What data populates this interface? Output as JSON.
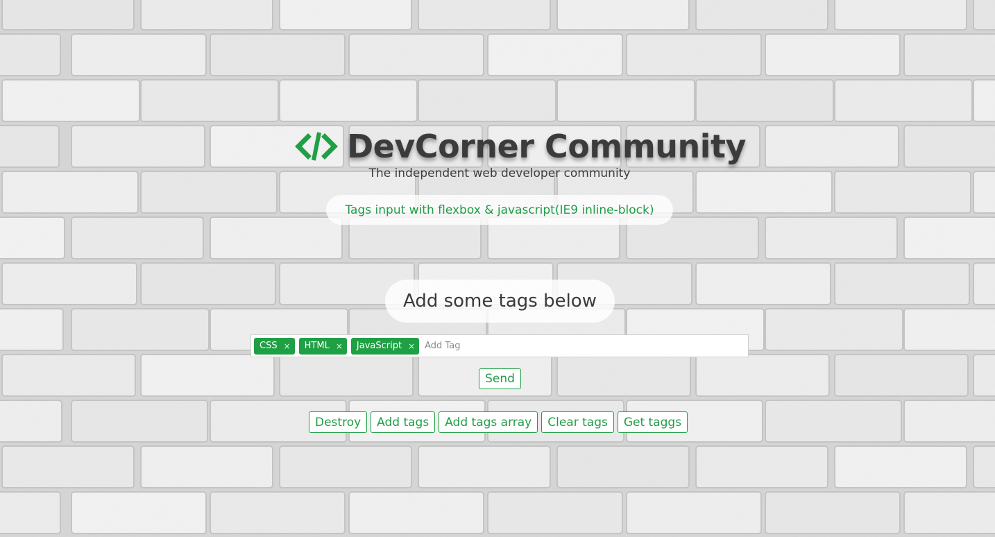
{
  "brand": {
    "title": "DevCorner Community",
    "subtitle": "The independent web developer community",
    "icon": "code-brackets-icon",
    "accent_color": "#1fa045"
  },
  "demo_link": {
    "label": "Tags input with flexbox & javascript(IE9 inline-block)"
  },
  "section": {
    "heading": "Add some tags below"
  },
  "tags_input": {
    "tags": [
      {
        "label": "CSS",
        "remove_symbol": "×"
      },
      {
        "label": "HTML",
        "remove_symbol": "×"
      },
      {
        "label": "JavaScript",
        "remove_symbol": "×"
      }
    ],
    "placeholder": "Add Tag",
    "value": ""
  },
  "actions": {
    "send_label": "Send",
    "buttons": [
      "Destroy",
      "Add tags",
      "Add tags array",
      "Clear tags",
      "Get taggs"
    ]
  }
}
